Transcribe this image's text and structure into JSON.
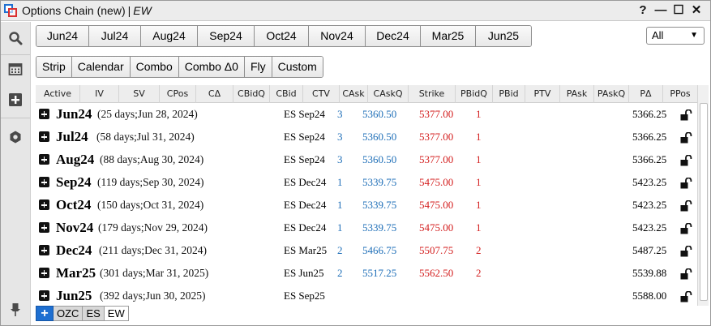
{
  "window": {
    "title": "Options Chain (new)",
    "separator": "|",
    "symbol": "EW",
    "controls": {
      "help": "?",
      "minimize": "—",
      "maximize": "☐",
      "close": "✕"
    }
  },
  "rail": {
    "icons": [
      "search-icon",
      "calendar-icon",
      "add-panel-icon",
      "settings-icon",
      "pin-icon"
    ]
  },
  "expiries": [
    "Jun24",
    "Jul24",
    "Aug24",
    "Sep24",
    "Oct24",
    "Nov24",
    "Dec24",
    "Mar25",
    "Jun25"
  ],
  "strategies": [
    "Strip",
    "Calendar",
    "Combo",
    "Combo Δ0",
    "Fly",
    "Custom"
  ],
  "filter": {
    "selected": "All"
  },
  "columns": [
    "Active",
    "IV",
    "SV",
    "CPos",
    "CΔ",
    "CBidQ",
    "CBid",
    "CTV",
    "CAsk",
    "CAskQ",
    "Strike",
    "PBidQ",
    "PBid",
    "PTV",
    "PAsk",
    "PAskQ",
    "PΔ",
    "PPos"
  ],
  "rows": [
    {
      "expiry": "Jun24",
      "info": "(25 days;Jun 28, 2024)",
      "ctv": "ES Sep24",
      "cask": "3",
      "caskq": "5360.50",
      "strike": "5377.00",
      "pbidq": "1",
      "pdelta": "5366.25"
    },
    {
      "expiry": "Jul24",
      "info": "(58 days;Jul 31, 2024)",
      "ctv": "ES Sep24",
      "cask": "3",
      "caskq": "5360.50",
      "strike": "5377.00",
      "pbidq": "1",
      "pdelta": "5366.25"
    },
    {
      "expiry": "Aug24",
      "info": "(88 days;Aug 30, 2024)",
      "ctv": "ES Sep24",
      "cask": "3",
      "caskq": "5360.50",
      "strike": "5377.00",
      "pbidq": "1",
      "pdelta": "5366.25"
    },
    {
      "expiry": "Sep24",
      "info": "(119 days;Sep 30, 2024)",
      "ctv": "ES Dec24",
      "cask": "1",
      "caskq": "5339.75",
      "strike": "5475.00",
      "pbidq": "1",
      "pdelta": "5423.25"
    },
    {
      "expiry": "Oct24",
      "info": "(150 days;Oct 31, 2024)",
      "ctv": "ES Dec24",
      "cask": "1",
      "caskq": "5339.75",
      "strike": "5475.00",
      "pbidq": "1",
      "pdelta": "5423.25"
    },
    {
      "expiry": "Nov24",
      "info": "(179 days;Nov 29, 2024)",
      "ctv": "ES Dec24",
      "cask": "1",
      "caskq": "5339.75",
      "strike": "5475.00",
      "pbidq": "1",
      "pdelta": "5423.25"
    },
    {
      "expiry": "Dec24",
      "info": "(211 days;Dec 31, 2024)",
      "ctv": "ES Mar25",
      "cask": "2",
      "caskq": "5466.75",
      "strike": "5507.75",
      "pbidq": "2",
      "pdelta": "5487.25"
    },
    {
      "expiry": "Mar25",
      "info": "(301 days;Mar 31, 2025)",
      "ctv": "ES Jun25",
      "cask": "2",
      "caskq": "5517.25",
      "strike": "5562.50",
      "pbidq": "2",
      "pdelta": "5539.88"
    },
    {
      "expiry": "Jun25",
      "info": "(392 days;Jun 30, 2025)",
      "ctv": "ES Sep25",
      "cask": "",
      "caskq": "",
      "strike": "",
      "pbidq": "",
      "pdelta": "5588.00"
    }
  ],
  "tabs": {
    "add": "+",
    "items": [
      "OZC",
      "ES",
      "EW"
    ],
    "active": "EW"
  },
  "colors": {
    "accent": "#1e6fd1",
    "call_blue": "#1f6fb8",
    "put_red": "#d42020"
  }
}
